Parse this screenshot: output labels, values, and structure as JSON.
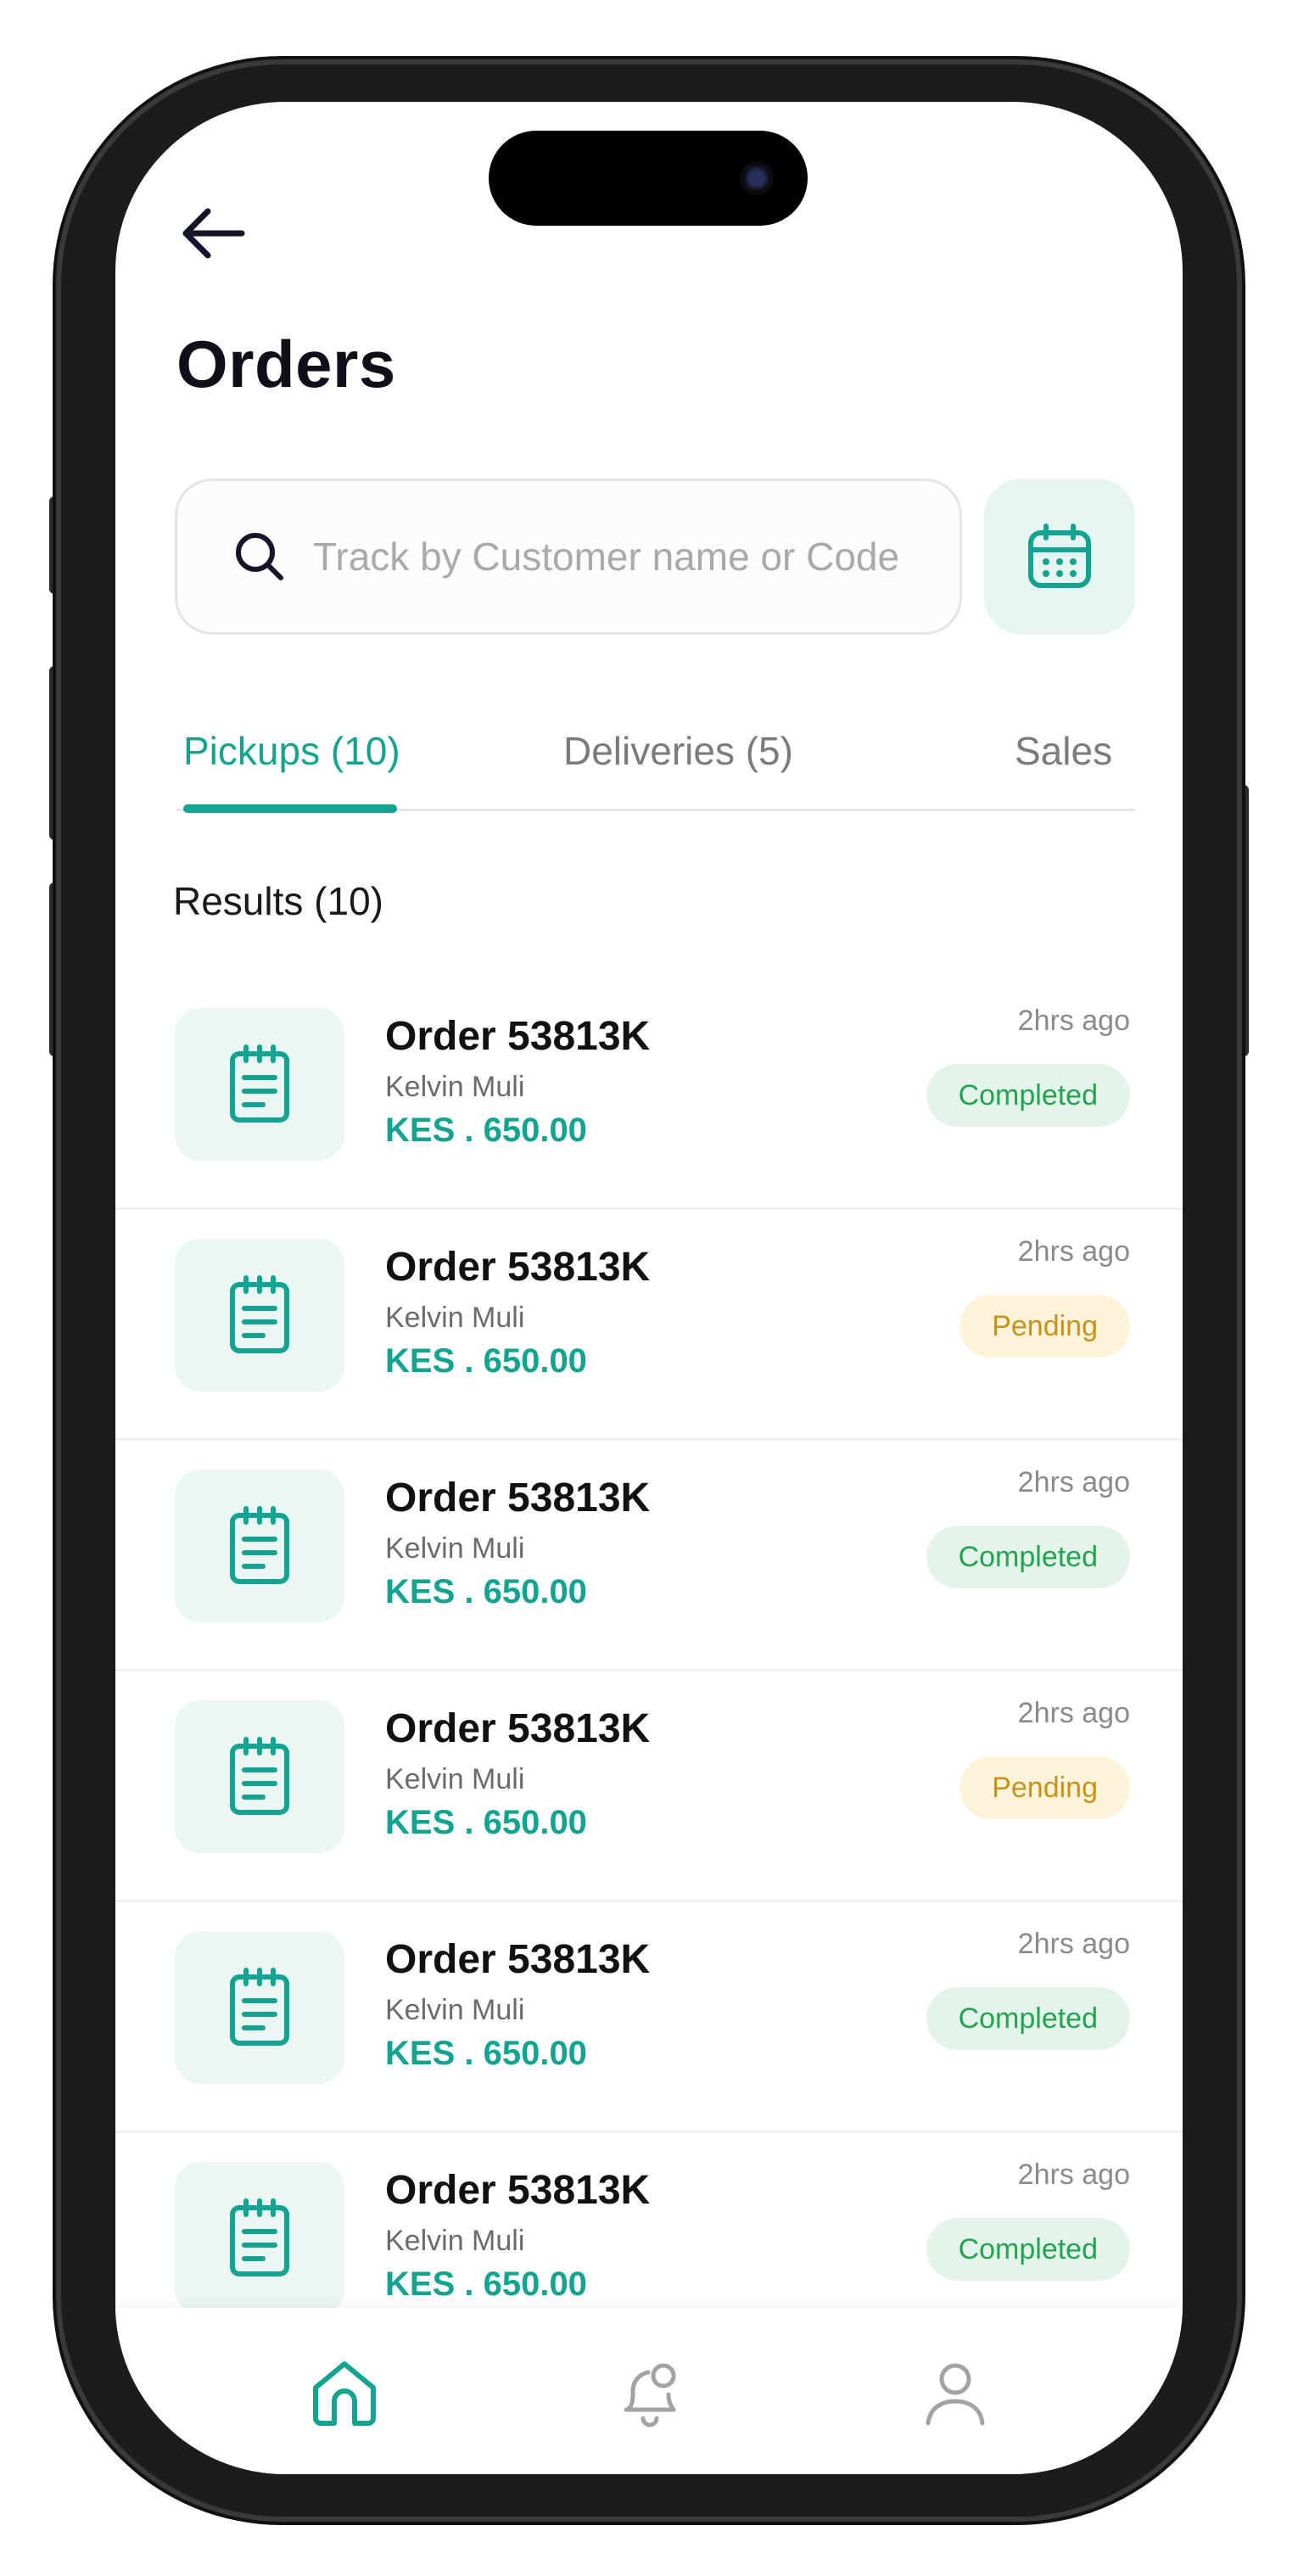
{
  "header": {
    "title": "Orders",
    "back_icon": "arrow-left-icon"
  },
  "search": {
    "placeholder": "Track by Customer name or Code",
    "value": "",
    "calendar_icon": "calendar-icon"
  },
  "tabs": [
    {
      "label": "Pickups (10)",
      "active": true
    },
    {
      "label": "Deliveries (5)",
      "active": false
    },
    {
      "label": "Sales",
      "active": false
    }
  ],
  "results": {
    "label": "Results (10)"
  },
  "orders": [
    {
      "title": "Order 53813K",
      "customer": "Kelvin Muli",
      "amount": "KES . 650.00",
      "time": "2hrs ago",
      "status": "Completed"
    },
    {
      "title": "Order 53813K",
      "customer": "Kelvin Muli",
      "amount": "KES . 650.00",
      "time": "2hrs ago",
      "status": "Pending"
    },
    {
      "title": "Order 53813K",
      "customer": "Kelvin Muli",
      "amount": "KES . 650.00",
      "time": "2hrs ago",
      "status": "Completed"
    },
    {
      "title": "Order 53813K",
      "customer": "Kelvin Muli",
      "amount": "KES . 650.00",
      "time": "2hrs ago",
      "status": "Pending"
    },
    {
      "title": "Order 53813K",
      "customer": "Kelvin Muli",
      "amount": "KES . 650.00",
      "time": "2hrs ago",
      "status": "Completed"
    },
    {
      "title": "Order 53813K",
      "customer": "Kelvin Muli",
      "amount": "KES . 650.00",
      "time": "2hrs ago",
      "status": "Completed"
    }
  ],
  "bottom_nav": [
    {
      "icon": "home-icon",
      "active": true
    },
    {
      "icon": "bell-icon",
      "active": false
    },
    {
      "icon": "user-icon",
      "active": false
    }
  ],
  "colors": {
    "accent": "#14a390",
    "completed_bg": "#e4f4ea",
    "completed_text": "#22a34f",
    "pending_bg": "#fdf3d8",
    "pending_text": "#c6921b"
  }
}
